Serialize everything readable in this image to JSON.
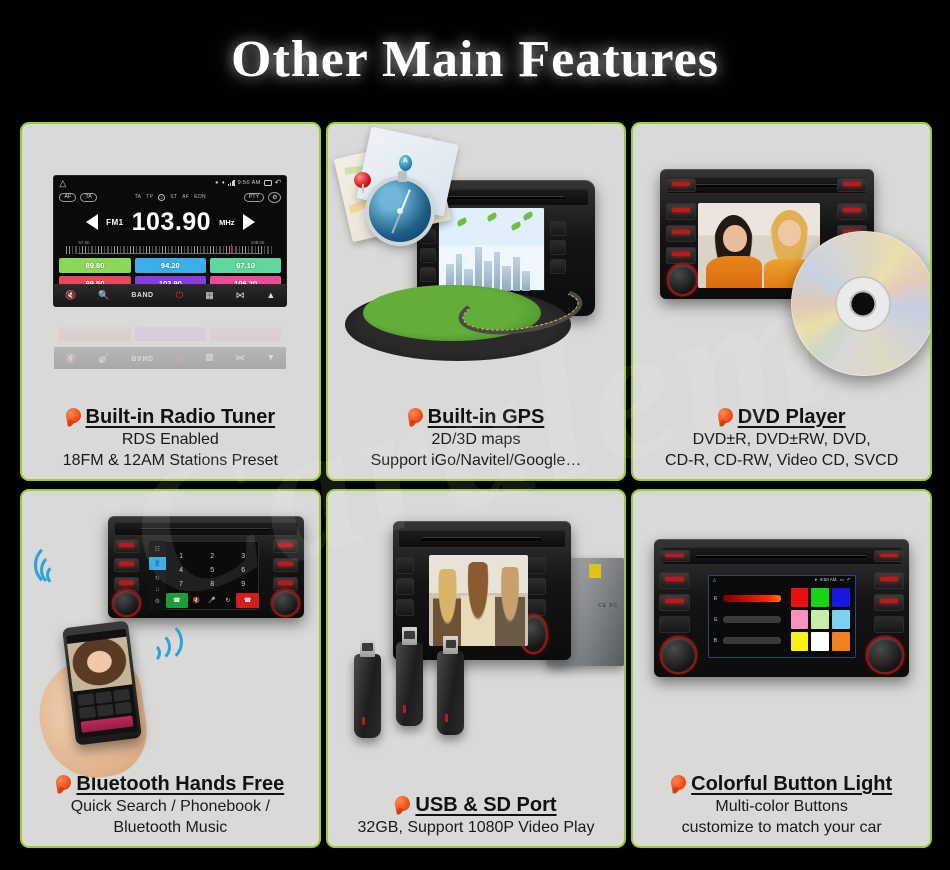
{
  "header": {
    "title": "Other Main Features"
  },
  "watermark": {
    "text": "Caralem"
  },
  "panels": [
    {
      "id": "radio",
      "caption_title": "Built-in Radio Tuner",
      "caption_lines": [
        "RDS Enabled",
        "18FM & 12AM Stations Preset"
      ],
      "screen": {
        "status": {
          "time": "9:50 AM",
          "icons": [
            "location-pin",
            "bluetooth",
            "signal-bars",
            "recents",
            "back"
          ]
        },
        "rds_left": [
          "AF",
          "TA"
        ],
        "rds_indicators": [
          "TA",
          "TP",
          "2",
          "ST",
          "AF",
          "EON"
        ],
        "rds_right": [
          "PTY",
          "settings"
        ],
        "band": "FM1",
        "frequency": "103.90",
        "unit": "MHz",
        "scale_min": "87.50",
        "scale_max": "108.00",
        "presets": [
          {
            "value": "89.80",
            "color": "#8cd65a"
          },
          {
            "value": "94.20",
            "color": "#3aafe8"
          },
          {
            "value": "97.10",
            "color": "#5fd79e"
          },
          {
            "value": "99.50",
            "color": "#e8475a"
          },
          {
            "value": "103.90",
            "color": "#8a3ce0"
          },
          {
            "value": "106.20",
            "color": "#ee4b96"
          }
        ],
        "toolbar": [
          "mute-icon",
          "search-icon",
          "BAND",
          "power-icon",
          "keypad-icon",
          "shuffle-icon",
          "equalizer-icon"
        ]
      }
    },
    {
      "id": "gps",
      "caption_title": "Built-in GPS",
      "caption_lines": [
        "2D/3D maps",
        "Support iGo/Navitel/Google…"
      ],
      "art": {
        "pin_label": "A"
      }
    },
    {
      "id": "dvd",
      "caption_title": "DVD Player",
      "caption_lines": [
        "DVD±R, DVD±RW, DVD,",
        "CD-R, CD-RW, Video CD, SVCD"
      ]
    },
    {
      "id": "bluetooth",
      "caption_title": "Bluetooth Hands Free",
      "caption_lines": [
        "Quick Search / Phonebook /",
        "Bluetooth Music"
      ],
      "screen": {
        "keys": [
          "1",
          "2",
          "3",
          "4",
          "5",
          "6",
          "7",
          "8",
          "9"
        ],
        "side_icons": [
          "dialpad-icon",
          "contacts-icon",
          "recents-icon",
          "music-icon",
          "settings-icon"
        ],
        "actions": [
          "call-icon",
          "mute-icon",
          "mic-icon",
          "refresh-icon",
          "end-call-icon"
        ]
      }
    },
    {
      "id": "usb",
      "caption_title": "USB & SD Port",
      "caption_lines": [
        "32GB, Support 1080P Video Play"
      ],
      "art": {
        "certification": "CE FC"
      }
    },
    {
      "id": "colorlight",
      "caption_title": "Colorful Button Light",
      "caption_lines": [
        "Multi-color Buttons",
        "customize to match your car"
      ],
      "screen": {
        "status_time": "9:50 AM",
        "slider_labels": [
          "R",
          "G",
          "B"
        ],
        "swatches": [
          "#e81010",
          "#18d418",
          "#1818e0",
          "#f890c0",
          "#c8ecaa",
          "#7cd0f0",
          "#f8f018",
          "#ffffff",
          "#f08020"
        ]
      }
    }
  ],
  "theme": {
    "background": "#000000",
    "panel_border": "#9acd32",
    "panel_background": "#d9d9d7",
    "title_color": "#ffffff",
    "bullet_color": "#f4531c"
  }
}
